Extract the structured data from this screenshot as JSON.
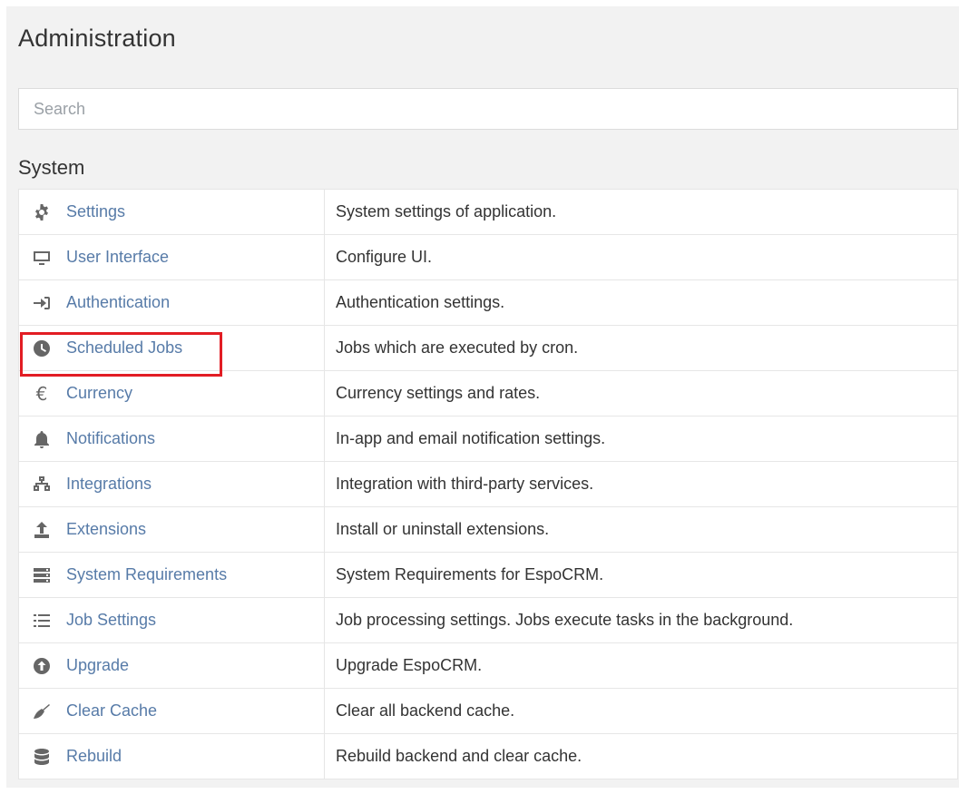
{
  "page": {
    "title": "Administration"
  },
  "search": {
    "placeholder": "Search"
  },
  "section": {
    "title": "System"
  },
  "rows": [
    {
      "label": "Settings",
      "description": "System settings of application.",
      "icon": "gear-icon"
    },
    {
      "label": "User Interface",
      "description": "Configure UI.",
      "icon": "monitor-icon"
    },
    {
      "label": "Authentication",
      "description": "Authentication settings.",
      "icon": "sign-in-icon"
    },
    {
      "label": "Scheduled Jobs",
      "description": "Jobs which are executed by cron.",
      "icon": "clock-icon"
    },
    {
      "label": "Currency",
      "description": "Currency settings and rates.",
      "icon": "euro-icon"
    },
    {
      "label": "Notifications",
      "description": "In-app and email notification settings.",
      "icon": "bell-icon"
    },
    {
      "label": "Integrations",
      "description": "Integration with third-party services.",
      "icon": "network-icon"
    },
    {
      "label": "Extensions",
      "description": "Install or uninstall extensions.",
      "icon": "upload-icon"
    },
    {
      "label": "System Requirements",
      "description": "System Requirements for EspoCRM.",
      "icon": "server-icon"
    },
    {
      "label": "Job Settings",
      "description": "Job processing settings. Jobs execute tasks in the background.",
      "icon": "list-icon"
    },
    {
      "label": "Upgrade",
      "description": "Upgrade EspoCRM.",
      "icon": "arrow-up-circle-icon"
    },
    {
      "label": "Clear Cache",
      "description": "Clear all backend cache.",
      "icon": "broom-icon"
    },
    {
      "label": "Rebuild",
      "description": "Rebuild backend and clear cache.",
      "icon": "database-icon"
    }
  ],
  "highlight": {
    "target": "Scheduled Jobs",
    "color": "#e21d24"
  },
  "colors": {
    "link": "#577ba8",
    "panel_background": "#f2f2f2"
  }
}
